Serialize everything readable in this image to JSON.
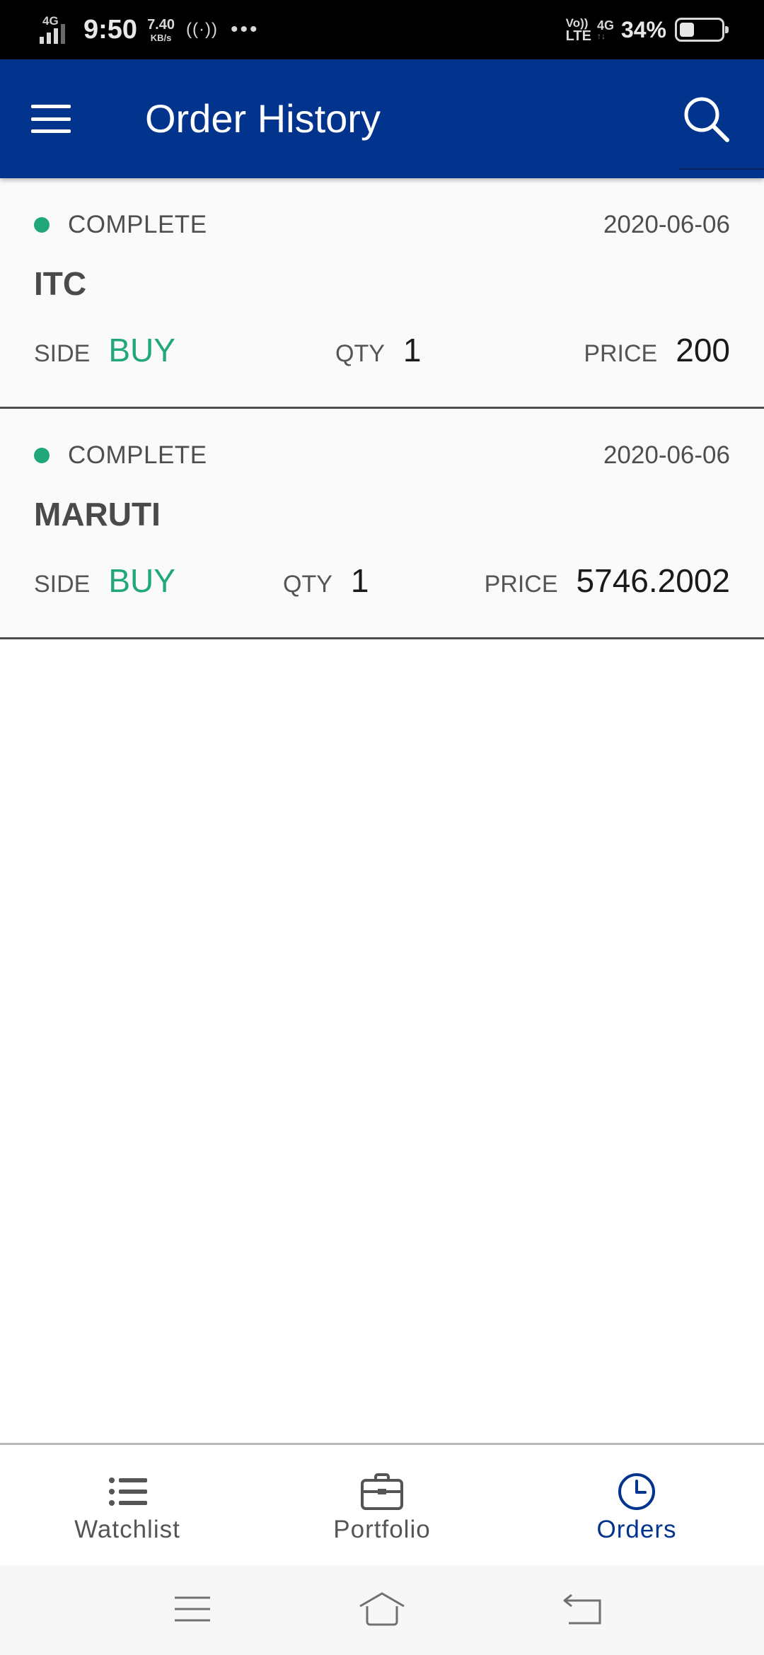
{
  "status_bar": {
    "network": "4G",
    "time": "9:50",
    "speed_value": "7.40",
    "speed_unit": "KB/s",
    "hotspot": "((·))",
    "more": "•••",
    "volte_top": "Vo))",
    "volte_bottom": "LTE",
    "net_right_top": "4G",
    "net_right_bottom": "↑↓",
    "battery_text": "34%",
    "battery_level": 0.34
  },
  "app_bar": {
    "title": "Order History",
    "menu_icon": "hamburger-menu-icon",
    "search_icon": "search-icon",
    "background": "#02338d"
  },
  "orders": [
    {
      "status": "COMPLETE",
      "date": "2020-06-06",
      "symbol": "ITC",
      "side_label": "SIDE",
      "side": "BUY",
      "qty_label": "QTY",
      "qty": "1",
      "price_label": "PRICE",
      "price": "200"
    },
    {
      "status": "COMPLETE",
      "date": "2020-06-06",
      "symbol": "MARUTI",
      "side_label": "SIDE",
      "side": "BUY",
      "qty_label": "QTY",
      "qty": "1",
      "price_label": "PRICE",
      "price": "5746.2002"
    }
  ],
  "colors": {
    "status_complete": "#20a77a",
    "side_buy": "#20a77a",
    "active_nav": "#02338d"
  },
  "bottom_nav": {
    "items": [
      {
        "label": "Watchlist",
        "icon": "list-icon",
        "active": false
      },
      {
        "label": "Portfolio",
        "icon": "briefcase-icon",
        "active": false
      },
      {
        "label": "Orders",
        "icon": "clock-icon",
        "active": true
      }
    ]
  },
  "system_nav": {
    "menu_icon": "system-menu-icon",
    "home_icon": "system-home-icon",
    "back_icon": "system-back-icon"
  }
}
